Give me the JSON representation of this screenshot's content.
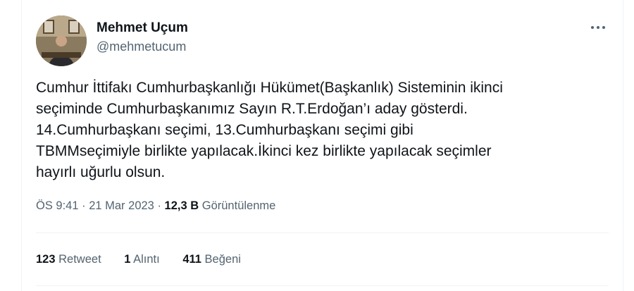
{
  "author": {
    "display_name": "Mehmet Uçum",
    "handle": "@mehmetucum"
  },
  "tweet": {
    "lines": [
      "Cumhur İttifakı Cumhurbaşkanlığı Hükümet(Başkanlık) Sisteminin ikinci",
      "seçiminde Cumhurbaşkanımız Sayın R.T.Erdoğan’ı aday gösterdi.",
      "14.Cumhurbaşkanı seçimi, 13.Cumhurbaşkanı seçimi gibi",
      "TBMMseçimiyle birlikte yapılacak.İkinci kez birlikte yapılacak seçimler",
      "hayırlı uğurlu olsun."
    ]
  },
  "meta": {
    "timestamp": "ÖS 9:41 · 21 Mar 2023",
    "separator": " · ",
    "views_count": "12,3 B",
    "views_label": "Görüntülenme"
  },
  "stats": {
    "retweets": {
      "count": "123",
      "label": "Retweet"
    },
    "quotes": {
      "count": "1",
      "label": "Alıntı"
    },
    "likes": {
      "count": "411",
      "label": "Beğeni"
    }
  },
  "icons": {
    "more": "more-horizontal-icon"
  },
  "colors": {
    "text_primary": "#0f1419",
    "text_secondary": "#536471",
    "divider": "#eff3f4"
  }
}
